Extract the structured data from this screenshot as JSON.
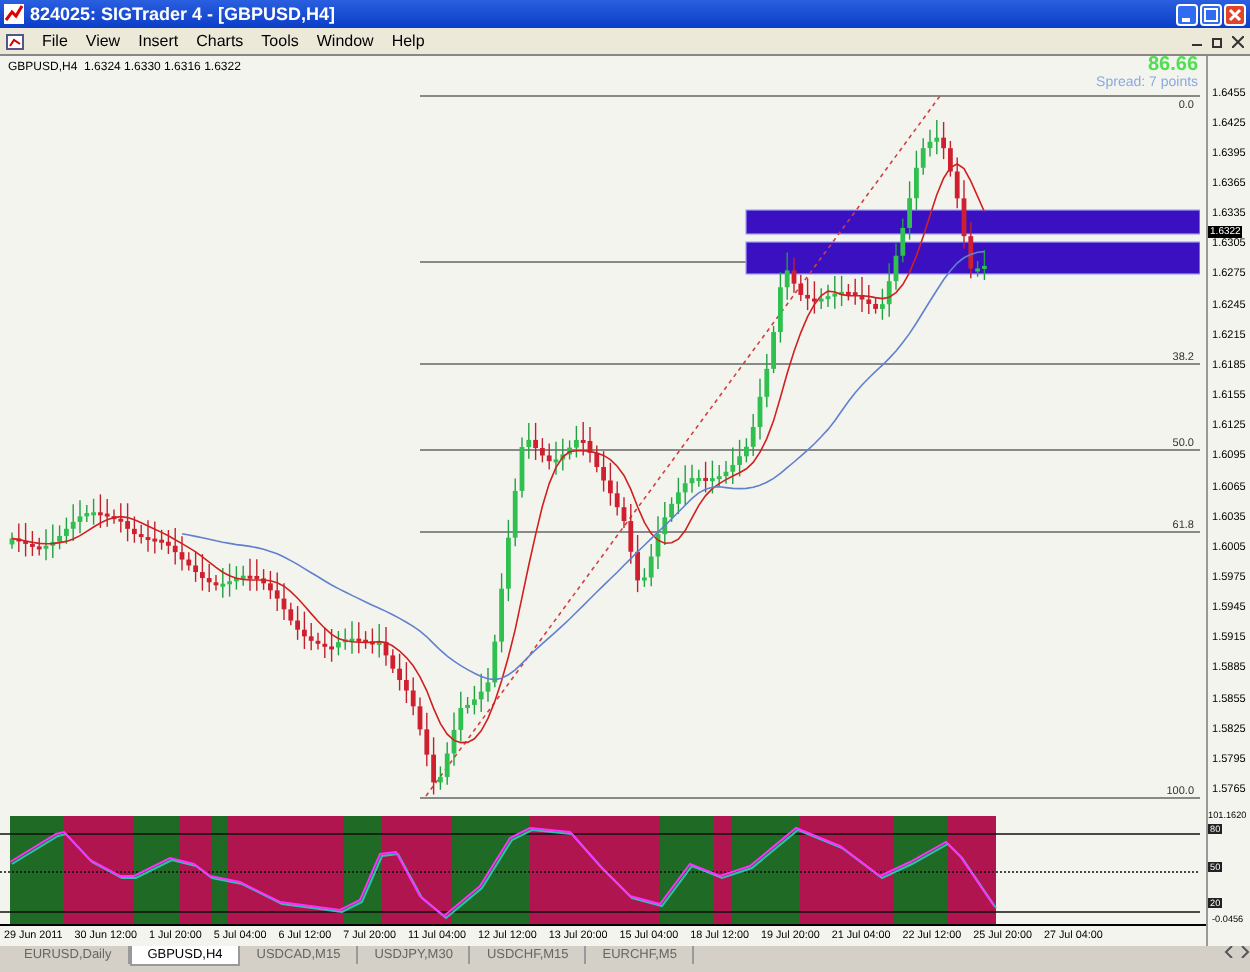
{
  "window": {
    "title": "824025: SIGTrader 4 - [GBPUSD,H4]"
  },
  "menu": [
    "File",
    "View",
    "Insert",
    "Charts",
    "Tools",
    "Window",
    "Help"
  ],
  "chart": {
    "symbol_info": "GBPUSD,H4  1.6324 1.6330 1.6316 1.6322",
    "profit": "86.66",
    "spread": "Spread: 7 points",
    "current_price": "1.6322",
    "price_axis": [
      "1.6455",
      "1.6425",
      "1.6395",
      "1.6365",
      "1.6335",
      "1.6305",
      "1.6275",
      "1.6245",
      "1.6215",
      "1.6185",
      "1.6155",
      "1.6125",
      "1.6095",
      "1.6065",
      "1.6035",
      "1.6005",
      "1.5975",
      "1.5945",
      "1.5915",
      "1.5885",
      "1.5855",
      "1.5825",
      "1.5795",
      "1.5765"
    ],
    "fib_levels": [
      "0.0",
      "38.2",
      "50.0",
      "61.8",
      "100.0"
    ],
    "time_axis": [
      "29 Jun 2011",
      "30 Jun 12:00",
      "1 Jul 20:00",
      "5 Jul 04:00",
      "6 Jul 12:00",
      "7 Jul 20:00",
      "11 Jul 04:00",
      "12 Jul 12:00",
      "13 Jul 20:00",
      "15 Jul 04:00",
      "18 Jul 12:00",
      "19 Jul 20:00",
      "21 Jul 04:00",
      "22 Jul 12:00",
      "25 Jul 20:00",
      "27 Jul 04:00"
    ]
  },
  "indicator": {
    "max": "101.1620",
    "levels": [
      "80",
      "50",
      "20"
    ],
    "min": "-0.0456"
  },
  "tabs": [
    {
      "label": "EURUSD,Daily",
      "selected": false
    },
    {
      "label": "GBPUSD,H4",
      "selected": true
    },
    {
      "label": "USDCAD,M15",
      "selected": false
    },
    {
      "label": "USDJPY,M30",
      "selected": false
    },
    {
      "label": "USDCHF,M15",
      "selected": false
    },
    {
      "label": "EURCHF,M5",
      "selected": false
    }
  ]
}
